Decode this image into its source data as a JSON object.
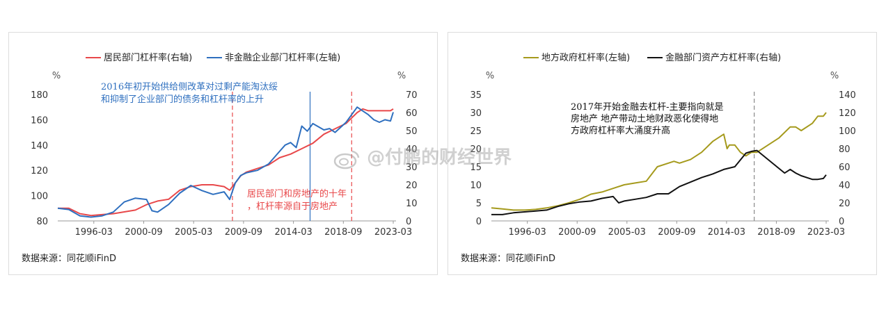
{
  "source_label": "数据来源：同花顺iFinD",
  "watermark": "@付鹏的财经世界",
  "chart_data": [
    {
      "type": "line",
      "x_ticks": [
        "1996-03",
        "2000-09",
        "2005-03",
        "2009-09",
        "2014-03",
        "2018-09",
        "2023-03"
      ],
      "xlim": [
        1993,
        2023.5
      ],
      "left_axis": {
        "unit": "%",
        "ylim": [
          80,
          180
        ],
        "ticks": [
          "180",
          "160",
          "140",
          "120",
          "100",
          "80"
        ]
      },
      "right_axis": {
        "unit": "%",
        "ylim": [
          0,
          70
        ],
        "ticks": [
          "70",
          "60",
          "50",
          "40",
          "30",
          "20",
          "10",
          "0"
        ]
      },
      "series": [
        {
          "name": "居民部门杠杆率(右轴)",
          "axis": "right",
          "color": "#e8484a",
          "x": [
            1993,
            1994,
            1995,
            1996,
            1997,
            1998,
            1999,
            2000,
            2001,
            2002,
            2003,
            2004,
            2005,
            2006,
            2007,
            2008,
            2008.5,
            2009,
            2009.5,
            2010,
            2011,
            2012,
            2013,
            2014,
            2015,
            2016,
            2017,
            2018,
            2019,
            2020,
            2020.5,
            2021,
            2022,
            2023,
            2023.25
          ],
          "y": [
            7,
            7,
            4,
            3,
            3.5,
            4,
            5,
            6,
            9,
            11,
            12,
            17,
            19,
            20,
            20,
            19,
            17,
            21,
            25,
            27,
            29,
            31,
            35,
            37,
            40,
            43,
            48,
            51,
            54,
            60,
            62,
            61,
            61,
            61,
            62
          ]
        },
        {
          "name": "非金融企业部门杠杆率(左轴)",
          "axis": "left",
          "color": "#2e6fbf",
          "x": [
            1993,
            1994,
            1995,
            1996,
            1997,
            1998,
            1999,
            2000,
            2001,
            2001.5,
            2002,
            2003,
            2004,
            2005,
            2006,
            2007,
            2008,
            2008.5,
            2009,
            2009.5,
            2010,
            2011,
            2012,
            2013,
            2013.5,
            2014,
            2014.5,
            2015,
            2015.5,
            2016,
            2017,
            2017.5,
            2018,
            2019,
            2020,
            2020.5,
            2021,
            2021.5,
            2022,
            2022.5,
            2023,
            2023.25
          ],
          "y": [
            90,
            89,
            84,
            83,
            84,
            87,
            95,
            98,
            97,
            88,
            87,
            93,
            102,
            108,
            104,
            101,
            103,
            97,
            110,
            116,
            118,
            120,
            125,
            135,
            140,
            142,
            138,
            155,
            151,
            157,
            152,
            153,
            150,
            158,
            170,
            167,
            164,
            160,
            158,
            160,
            159,
            166
          ]
        }
      ],
      "vlines": [
        {
          "x": 2008.75,
          "style": "dashed",
          "color": "#e8484a"
        },
        {
          "x": 2015.75,
          "style": "solid",
          "color": "#2e6fbf"
        },
        {
          "x": 2019.5,
          "style": "dashed",
          "color": "#e8484a"
        }
      ],
      "annotations": [
        {
          "lines": [
            "2016年初开始供给侧改革对过剩产能淘汰绥",
            "和抑制了企业部门的债务和杠杆率的上升"
          ],
          "color": "#2e6fbf"
        },
        {
          "lines": [
            "居民部门和房地产的十年",
            "，杠杆率源自于房地产"
          ],
          "color": "#e8484a"
        }
      ]
    },
    {
      "type": "line",
      "x_ticks": [
        "1996-03",
        "2000-09",
        "2005-03",
        "2009-09",
        "2014-03",
        "2018-09",
        "2023-03"
      ],
      "xlim": [
        1993,
        2023.5
      ],
      "left_axis": {
        "unit": "%",
        "ylim": [
          0,
          35
        ],
        "ticks": [
          "35",
          "30",
          "25",
          "20",
          "15",
          "10",
          "5",
          "0"
        ]
      },
      "right_axis": {
        "unit": "%",
        "ylim": [
          0,
          140
        ],
        "ticks": [
          "140",
          "120",
          "100",
          "80",
          "60",
          "40",
          "20",
          "0"
        ]
      },
      "series": [
        {
          "name": "地方政府杠杆率(左轴)",
          "axis": "left",
          "color": "#a59a1c",
          "x": [
            1993,
            1994,
            1995,
            1996,
            1997,
            1998,
            1999,
            2000,
            2001,
            2002,
            2003,
            2004,
            2005,
            2006,
            2007,
            2008,
            2009,
            2009.5,
            2010,
            2011,
            2012,
            2013,
            2014,
            2014.3,
            2014.5,
            2015,
            2015.5,
            2016,
            2016.5,
            2017,
            2018,
            2019,
            2020,
            2020.5,
            2021,
            2022,
            2022.5,
            2023,
            2023.25
          ],
          "y": [
            3.6,
            3.3,
            3,
            3,
            3.2,
            3.6,
            4.2,
            5,
            6,
            7.4,
            8,
            9,
            10,
            10.5,
            11,
            15,
            16,
            16.5,
            16,
            17,
            19,
            22,
            24,
            20,
            21,
            21,
            19,
            18,
            19,
            19,
            21,
            23,
            26,
            26,
            25,
            27,
            29,
            29,
            30
          ]
        },
        {
          "name": "金融部门资产方杠杆率(右轴)",
          "axis": "right",
          "color": "#111111",
          "x": [
            1993,
            1994,
            1995,
            1996,
            1997,
            1998,
            1999,
            2000,
            2001,
            2002,
            2003,
            2004,
            2004.5,
            2005,
            2006,
            2007,
            2008,
            2009,
            2010,
            2011,
            2012,
            2013,
            2014,
            2015,
            2016,
            2016.5,
            2017,
            2018,
            2019,
            2019.5,
            2020,
            2020.5,
            2021,
            2022,
            2022.5,
            2023,
            2023.25
          ],
          "y": [
            7,
            7,
            9,
            10,
            11,
            12,
            16,
            19,
            21,
            22,
            25,
            27,
            20,
            22,
            24,
            26,
            30,
            30,
            38,
            43,
            48,
            52,
            57,
            60,
            75,
            77,
            78,
            68,
            58,
            53,
            57,
            53,
            50,
            46,
            46,
            47,
            51
          ]
        }
      ],
      "vlines": [
        {
          "x": 2016.75,
          "style": "dashed",
          "color": "#888888"
        }
      ],
      "annotations": [
        {
          "lines": [
            "2017年开始金融去杠杆-主要指向就是",
            "房地产  地产带动土地财政恶化使得地",
            "方政府杠杆率大涌度升高"
          ],
          "color": "#111111"
        }
      ]
    }
  ]
}
